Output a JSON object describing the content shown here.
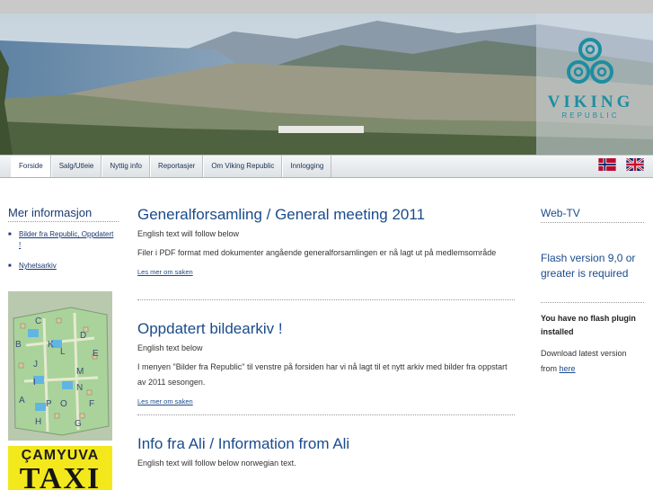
{
  "brand": {
    "name": "VIKING",
    "subtitle": "REPUBLIC",
    "color": "#1c8ea0"
  },
  "nav": {
    "items": [
      {
        "label": "Forside",
        "active": true
      },
      {
        "label": "Salg/Utleie"
      },
      {
        "label": "Nyttig info"
      },
      {
        "label": "Reportasjer"
      },
      {
        "label": "Om Viking Republic"
      },
      {
        "label": "Innlogging"
      }
    ],
    "flags": [
      "norwegian-flag-icon",
      "uk-flag-icon"
    ]
  },
  "sidebar": {
    "title": "Mer informasjon",
    "links": [
      "Bilder fra Republic, Oppdatert !",
      "Nyhetsarkiv"
    ],
    "map_letters": [
      "C",
      "B",
      "K",
      "L",
      "D",
      "J",
      "M",
      "E",
      "I",
      "N",
      "A",
      "P",
      "O",
      "F",
      "H",
      "G"
    ],
    "ad": {
      "line1": "ÇAMYUVA",
      "line2": "TAXI"
    }
  },
  "articles": [
    {
      "title": "Generalforsamling / General meeting 2011",
      "english_note": "English text will follow below",
      "body": "Filer i PDF format med dokumenter angående generalforsamlingen er nå lagt ut på medlemsområde",
      "more": "Les mer om saken"
    },
    {
      "title": "Oppdatert bildearkiv !",
      "english_note": "English text below",
      "body": "I menyen \"Bilder fra Republic\" til venstre på forsiden har vi nå lagt til et nytt arkiv med bilder fra oppstart av 2011 sesongen.",
      "more": "Les mer om saken"
    },
    {
      "title": "Info fra Ali / Information from Ali",
      "english_note": "English text will follow below norwegian text."
    }
  ],
  "right": {
    "title": "Web-TV",
    "flash_title": "Flash version 9,0 or greater is required",
    "no_flash": "You have no flash plugin installed",
    "download_text": "Download latest version from",
    "download_link": "here"
  },
  "colors": {
    "link": "#1a4b8c",
    "nav_text": "#1a2f54",
    "taxi_yellow": "#f3e81c"
  }
}
